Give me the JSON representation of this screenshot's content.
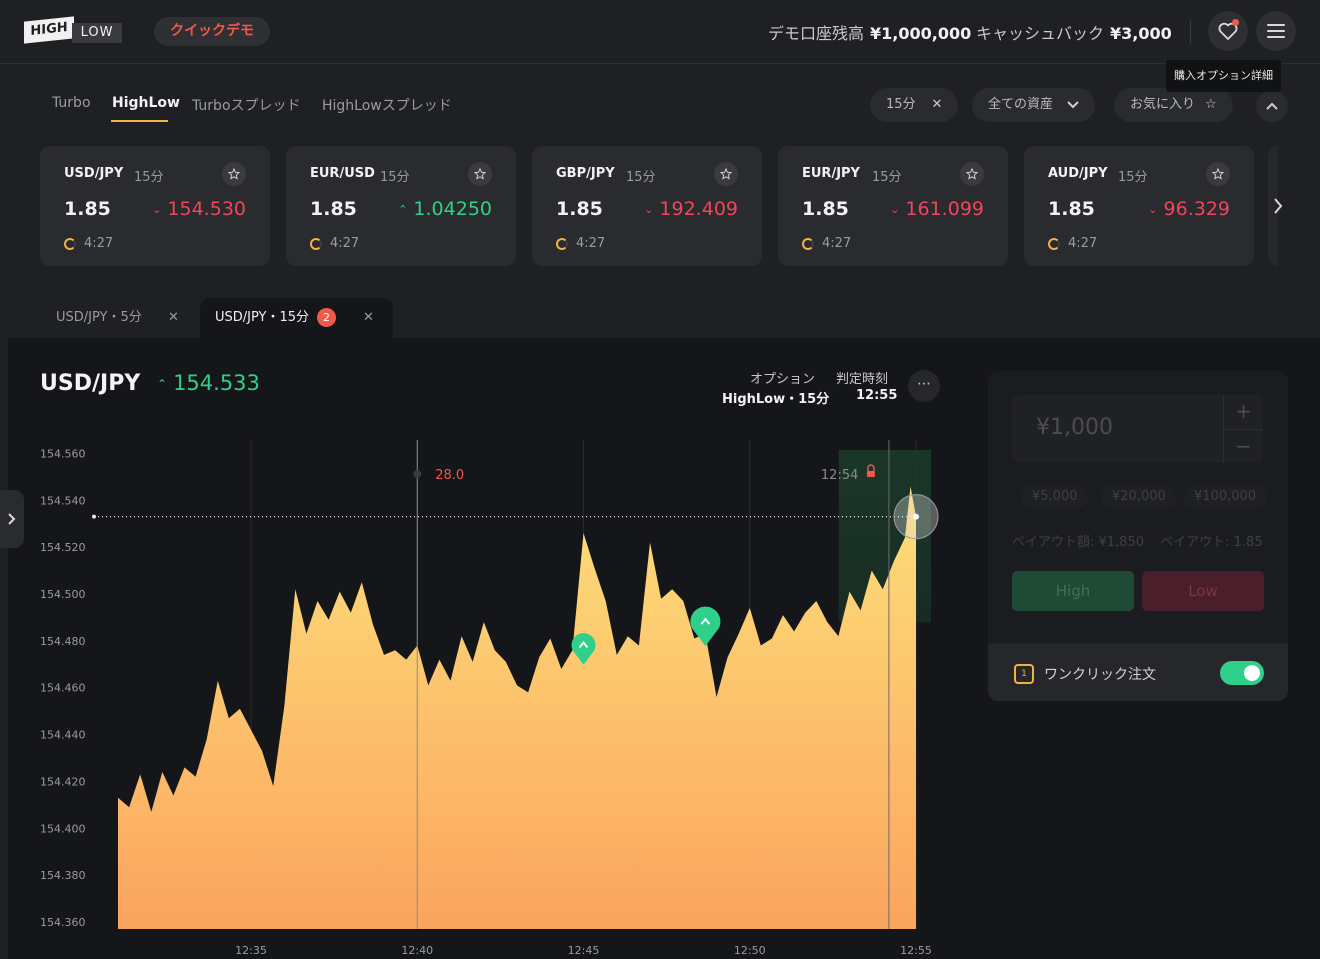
{
  "header": {
    "logo_high": "HIGH",
    "logo_low": "LOW",
    "demo_label": "クイックデモ",
    "balance_label": "デモ口座残高",
    "balance_value": "¥1,000,000",
    "cashback_label": "キャッシュバック",
    "cashback_value": "¥3,000",
    "tooltip": "購入オプション詳細",
    "icons": [
      "heart-notification-icon",
      "hamburger-menu-icon"
    ]
  },
  "option_tabs": [
    "Turbo",
    "HighLow",
    "Turboスプレッド",
    "HighLowスプレッド"
  ],
  "active_option_tab": "HighLow",
  "filters": {
    "duration": "15分",
    "assets": "全ての資産",
    "favorites": "お気に入り"
  },
  "cards": [
    {
      "symbol": "USD/JPY",
      "duration": "15分",
      "payout": "1.85",
      "price": "154.530",
      "direction": "down",
      "timer": "4:27"
    },
    {
      "symbol": "EUR/USD",
      "duration": "15分",
      "payout": "1.85",
      "price": "1.04250",
      "direction": "up",
      "timer": "4:27"
    },
    {
      "symbol": "GBP/JPY",
      "duration": "15分",
      "payout": "1.85",
      "price": "192.409",
      "direction": "down",
      "timer": "4:27"
    },
    {
      "symbol": "EUR/JPY",
      "duration": "15分",
      "payout": "1.85",
      "price": "161.099",
      "direction": "down",
      "timer": "4:27"
    },
    {
      "symbol": "AUD/JPY",
      "duration": "15分",
      "payout": "1.85",
      "price": "96.329",
      "direction": "down",
      "timer": "4:27"
    }
  ],
  "chart_tabs": [
    {
      "label": "USD/JPY・5分",
      "active": false
    },
    {
      "label": "USD/JPY・15分",
      "active": true,
      "badge": "2"
    }
  ],
  "chart_header": {
    "pair": "USD/JPY",
    "price": "154.533",
    "option_label": "オプション",
    "option_value": "HighLow・15分",
    "expiry_label": "判定時刻",
    "expiry_value": "12:55"
  },
  "chart_data": {
    "type": "area",
    "title": "",
    "xlabel": "",
    "ylabel": "",
    "x_ticks": [
      "12:35",
      "12:40",
      "12:45",
      "12:50",
      "12:55"
    ],
    "y_ticks": [
      154.56,
      154.54,
      154.52,
      154.5,
      154.48,
      154.46,
      154.44,
      154.42,
      154.4,
      154.38,
      154.36
    ],
    "ylim": [
      154.357,
      154.57
    ],
    "series": [
      {
        "values": [
          [
            "12:31:00",
            154.413
          ],
          [
            "12:31:20",
            154.409
          ],
          [
            "12:31:40",
            154.423
          ],
          [
            "12:32:00",
            154.407
          ],
          [
            "12:32:20",
            154.424
          ],
          [
            "12:32:40",
            154.414
          ],
          [
            "12:33:00",
            154.426
          ],
          [
            "12:33:20",
            154.422
          ],
          [
            "12:33:40",
            154.438
          ],
          [
            "12:34:00",
            154.463
          ],
          [
            "12:34:20",
            154.447
          ],
          [
            "12:34:40",
            154.451
          ],
          [
            "12:35:00",
            154.442
          ],
          [
            "12:35:20",
            154.433
          ],
          [
            "12:35:40",
            154.418
          ],
          [
            "12:36:00",
            154.452
          ],
          [
            "12:36:20",
            154.502
          ],
          [
            "12:36:40",
            154.483
          ],
          [
            "12:37:00",
            154.497
          ],
          [
            "12:37:20",
            154.489
          ],
          [
            "12:37:40",
            154.501
          ],
          [
            "12:38:00",
            154.492
          ],
          [
            "12:38:20",
            154.505
          ],
          [
            "12:38:40",
            154.487
          ],
          [
            "12:39:00",
            154.474
          ],
          [
            "12:39:20",
            154.476
          ],
          [
            "12:39:40",
            154.472
          ],
          [
            "12:40:00",
            154.478
          ],
          [
            "12:40:20",
            154.461
          ],
          [
            "12:40:40",
            154.472
          ],
          [
            "12:41:00",
            154.463
          ],
          [
            "12:41:20",
            154.482
          ],
          [
            "12:41:40",
            154.471
          ],
          [
            "12:42:00",
            154.488
          ],
          [
            "12:42:20",
            154.476
          ],
          [
            "12:42:40",
            154.471
          ],
          [
            "12:43:00",
            154.461
          ],
          [
            "12:43:20",
            154.458
          ],
          [
            "12:43:40",
            154.473
          ],
          [
            "12:44:00",
            154.481
          ],
          [
            "12:44:20",
            154.468
          ],
          [
            "12:44:40",
            154.476
          ],
          [
            "12:45:00",
            154.526
          ],
          [
            "12:45:20",
            154.511
          ],
          [
            "12:45:40",
            154.497
          ],
          [
            "12:46:00",
            154.474
          ],
          [
            "12:46:20",
            154.482
          ],
          [
            "12:46:40",
            154.478
          ],
          [
            "12:47:00",
            154.522
          ],
          [
            "12:47:20",
            154.498
          ],
          [
            "12:47:40",
            154.502
          ],
          [
            "12:48:00",
            154.497
          ],
          [
            "12:48:20",
            154.481
          ],
          [
            "12:48:40",
            154.483
          ],
          [
            "12:49:00",
            154.456
          ],
          [
            "12:49:20",
            154.473
          ],
          [
            "12:49:40",
            154.483
          ],
          [
            "12:50:00",
            154.494
          ],
          [
            "12:50:20",
            154.478
          ],
          [
            "12:50:40",
            154.481
          ],
          [
            "12:51:00",
            154.491
          ],
          [
            "12:51:20",
            154.484
          ],
          [
            "12:51:40",
            154.492
          ],
          [
            "12:52:00",
            154.497
          ],
          [
            "12:52:20",
            154.488
          ],
          [
            "12:52:40",
            154.482
          ],
          [
            "12:53:00",
            154.501
          ],
          [
            "12:53:20",
            154.493
          ],
          [
            "12:53:40",
            154.51
          ],
          [
            "12:54:00",
            154.502
          ],
          [
            "12:54:20",
            154.514
          ],
          [
            "12:54:40",
            154.524
          ],
          [
            "12:54:50",
            154.546
          ],
          [
            "12:55:00",
            154.533
          ]
        ]
      }
    ],
    "current_price": 154.533,
    "entry_markers": [
      {
        "time": "12:45:00",
        "price": 154.478,
        "direction": "high"
      },
      {
        "time": "12:48:40",
        "price": 154.488,
        "direction": "high"
      }
    ],
    "marker_label": "28.0",
    "deadline_label": "12:54",
    "grid": true,
    "colors": {
      "area_top": "#fde07a",
      "area_bottom": "#fba45e",
      "marker": "#2fd08a",
      "label_red": "#f05a4a"
    }
  },
  "trade_panel": {
    "amount": "¥1,000",
    "plus": "+",
    "minus": "−",
    "presets": [
      "¥5,000",
      "¥20,000",
      "¥100,000"
    ],
    "payout_amount": "ペイアウト額: ¥1,850",
    "payout_rate": "ペイアウト: 1.85",
    "high_label": "High",
    "low_label": "Low",
    "oneclick_label": "ワンクリック注文",
    "oneclick_enabled": true
  },
  "colors": {
    "accent": "#f4b23e",
    "up": "#2fd08a",
    "down": "#f0455a",
    "demo": "#f05a4a"
  }
}
